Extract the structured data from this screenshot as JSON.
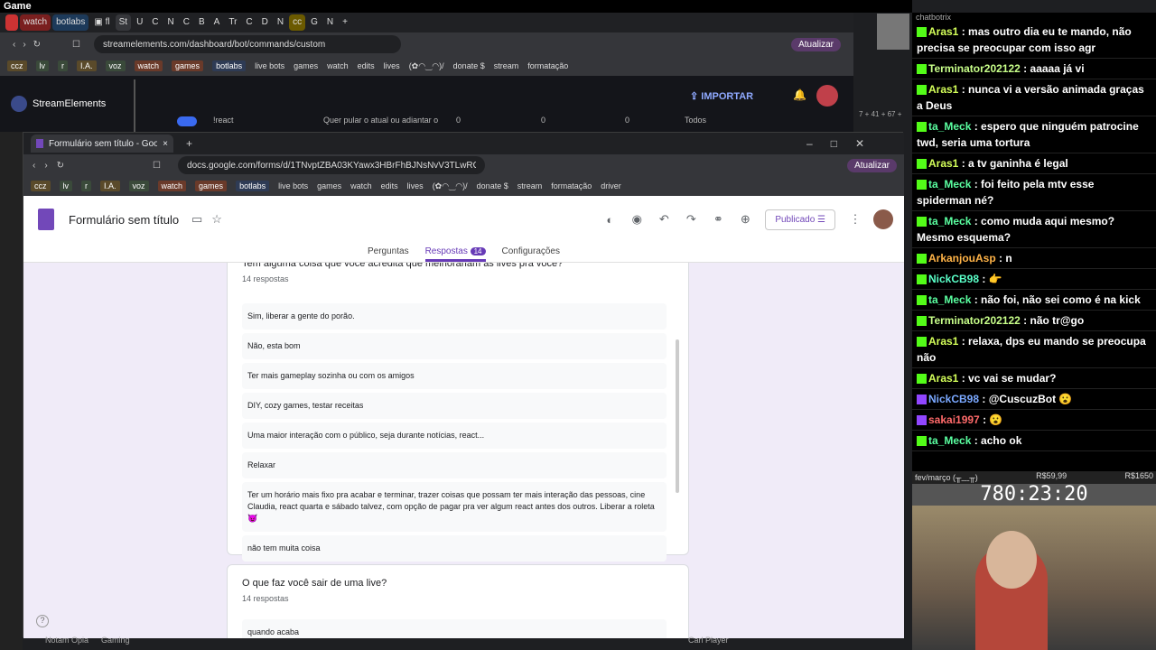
{
  "os": {
    "title": "Game",
    "bottom_left": "Notam Opia",
    "bottom_gaming": "Gaming",
    "bottom_car": "Carl Player"
  },
  "browser1": {
    "tabs": [
      "watch",
      "botlabs",
      "St",
      "U",
      "C",
      "N",
      "C",
      "B",
      "A",
      "Tr",
      "C",
      "D",
      "N",
      "cc",
      "G",
      "N"
    ],
    "url": "streamelements.com/dashboard/bot/commands/custom",
    "update_label": "Atualizar",
    "bookmarks": [
      "ccz",
      "lv",
      "r",
      "I.A.",
      "voz",
      "watch",
      "games",
      "botlabs",
      "live bots",
      "games",
      "watch",
      "edits",
      "lives",
      "(✿◠‿◠)/",
      "donate $",
      "stream",
      "formatação"
    ],
    "se_logo": "StreamElements",
    "import_label": "IMPORTAR",
    "cmd_row": {
      "name": "!react",
      "desc": "Quer pular o atual ou adiantar o",
      "v1": "0",
      "v2": "0",
      "v3": "0",
      "scope": "Todos"
    },
    "count": "7 + 41 + 67 +"
  },
  "browser2": {
    "tab_title": "Formulário sem título - Google F",
    "url": "docs.google.com/forms/d/1TNvptZBA03KYawx3HBrFhBJNsNvV3TLwROB...",
    "update_label": "Atualizar",
    "bookmarks": [
      "ccz",
      "lv",
      "r",
      "I.A.",
      "voz",
      "watch",
      "games",
      "botlabs",
      "live bots",
      "games",
      "watch",
      "edits",
      "lives",
      "(✿◠‿◠)/",
      "donate $",
      "stream",
      "formatação",
      "driver"
    ],
    "form_title": "Formulário sem título",
    "published_label": "Publicado",
    "nav": [
      "Perguntas",
      "Respostas",
      "Configurações"
    ],
    "responses_badge": "14",
    "q1": "Tem alguma coisa que você acredita que melhorariam as lives pra você?",
    "q1_count": "14 respostas",
    "answers": [
      "Sim, liberar a gente do porão.",
      "Não, esta bom",
      "Ter mais gameplay sozinha ou com os amigos",
      "DIY, cozy games, testar receitas",
      "Uma maior interação com o público, seja durante notícias, react...",
      "Relaxar",
      "Ter um horário mais fixo pra acabar e terminar, trazer coisas que possam ter mais interação das pessoas, cine Claudia, react quarta e sábado talvez, com opção de pagar pra ver algum react antes dos outros. Liberar a roleta 😈",
      "não tem muita coisa"
    ],
    "q2": "O que faz você sair de uma live?",
    "q2_count": "14 respostas",
    "q2_first": "quando acaba"
  },
  "chat": {
    "header": "chatbotrix",
    "messages": [
      {
        "user": "Aras1",
        "text": "mas outro dia eu te mando, não precisa se preocupar com isso agr",
        "color": "#d4ff5a",
        "tw": false
      },
      {
        "user": "Terminator202122",
        "text": "aaaaa já vi",
        "color": "#c8ff8a",
        "tw": false
      },
      {
        "user": "Aras1",
        "text": "nunca vi a versão animada graças a Deus",
        "color": "#d4ff5a",
        "tw": false
      },
      {
        "user": "ta_Meck",
        "text": "espero que ninguém patrocine twd, seria uma tortura",
        "color": "#5affa0",
        "tw": false
      },
      {
        "user": "Aras1",
        "text": "a tv ganinha é legal",
        "color": "#d4ff5a",
        "tw": false
      },
      {
        "user": "ta_Meck",
        "text": "foi feito pela mtv esse spiderman né?",
        "color": "#5affa0",
        "tw": false
      },
      {
        "user": "ta_Meck",
        "text": "como muda aqui mesmo? Mesmo esquema?",
        "color": "#5affa0",
        "tw": false
      },
      {
        "user": "ArkanjouAsp",
        "text": "n",
        "color": "#ffb347",
        "tw": false
      },
      {
        "user": "NickCB98",
        "text": "👉",
        "color": "#5affc8",
        "tw": false
      },
      {
        "user": "ta_Meck",
        "text": "não foi, não sei como é na kick",
        "color": "#5affa0",
        "tw": false
      },
      {
        "user": "Terminator202122",
        "text": "não tr@go",
        "color": "#c8ff8a",
        "tw": false
      },
      {
        "user": "Aras1",
        "text": "relaxa, dps eu mando se preocupa não",
        "color": "#d4ff5a",
        "tw": false
      },
      {
        "user": "Aras1",
        "text": "vc vai se mudar?",
        "color": "#d4ff5a",
        "tw": false
      },
      {
        "user": "NickCB98",
        "text": "@CuscuzBot 😮",
        "color": "#7aa8ff",
        "tw": true
      },
      {
        "user": "sakai1997",
        "text": "😮",
        "color": "#ff6a6a",
        "tw": true
      },
      {
        "user": "ta_Meck",
        "text": "acho ok",
        "color": "#5affa0",
        "tw": false
      }
    ]
  },
  "overlay": {
    "left": "fev/março (╥﹏╥)",
    "mid": "R$59,99",
    "right": "R$1650",
    "timer": "780:23:20"
  }
}
